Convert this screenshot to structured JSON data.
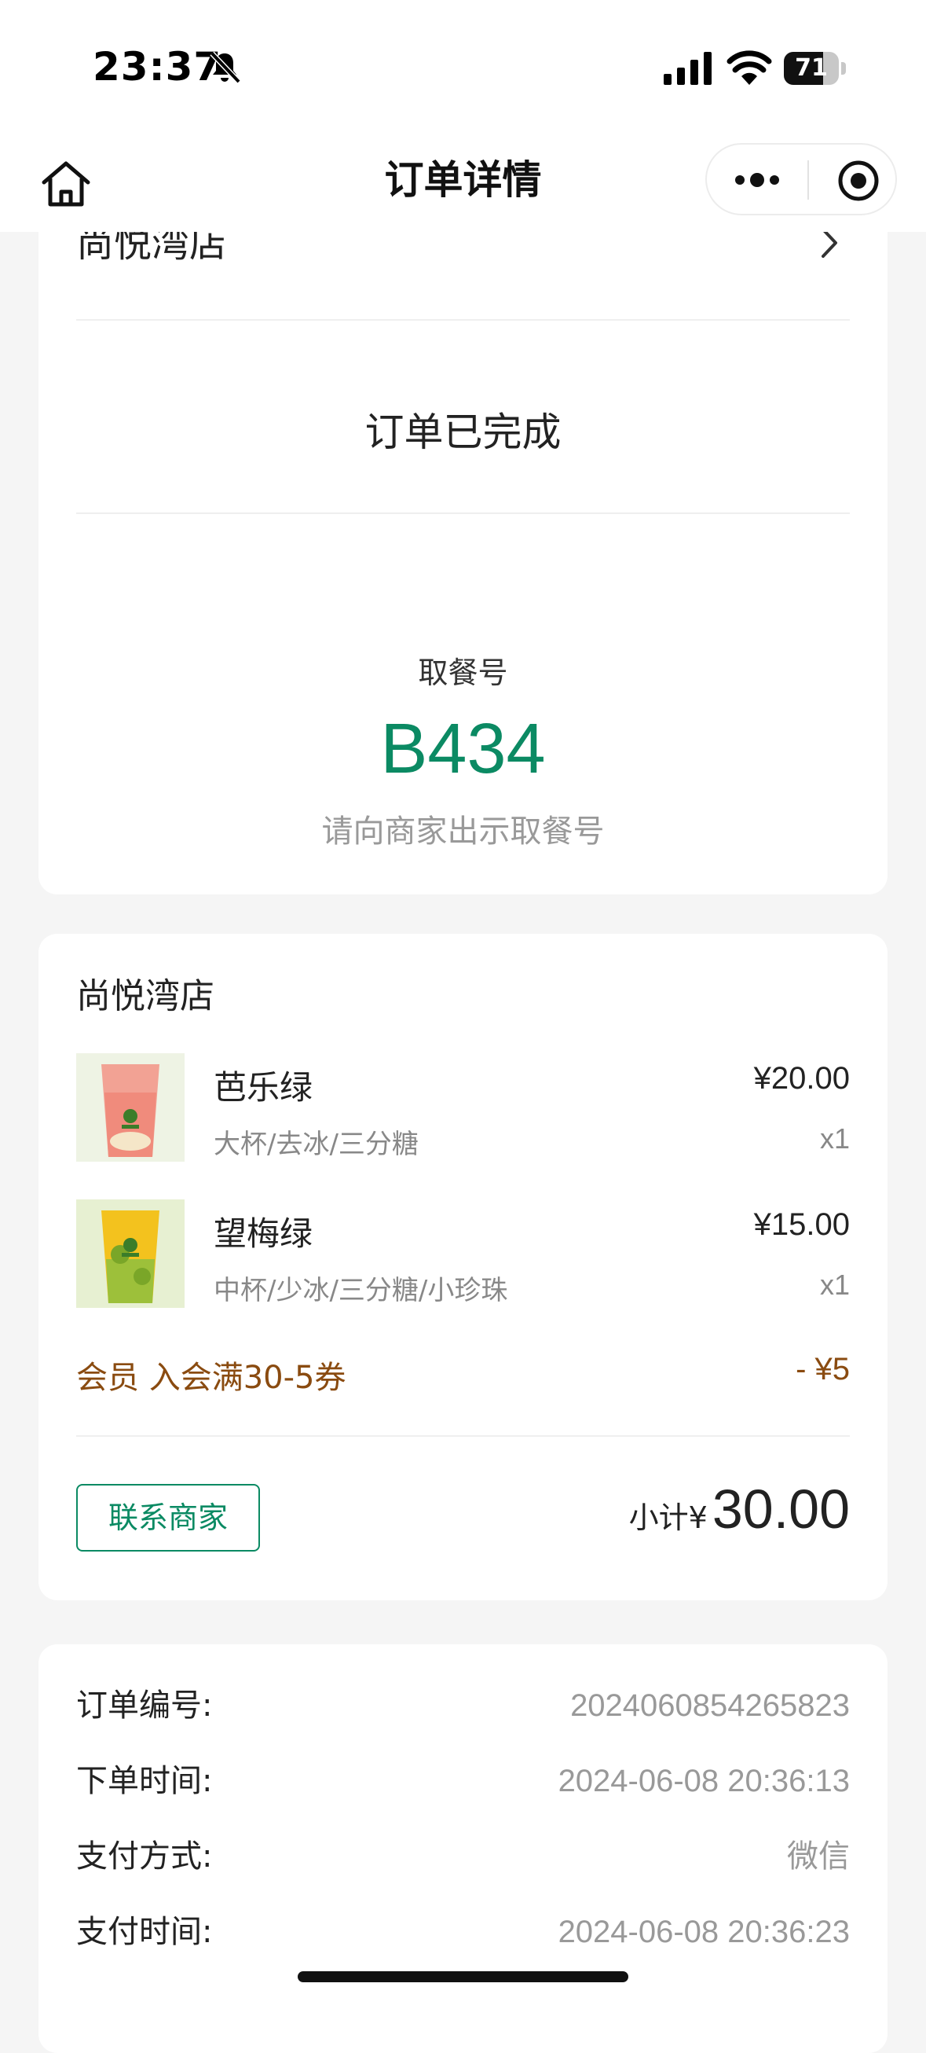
{
  "status_bar": {
    "time": "23:37",
    "battery": "71",
    "battery_level": 0.71
  },
  "nav": {
    "title": "订单详情"
  },
  "status_card": {
    "store_name": "尚悦湾店",
    "order_status": "订单已完成",
    "pickup_label": "取餐号",
    "pickup_number": "B434",
    "pickup_hint": "请向商家出示取餐号"
  },
  "order_card": {
    "store_name": "尚悦湾店",
    "items": [
      {
        "name": "芭乐绿",
        "spec": "大杯/去冰/三分糖",
        "price": "¥20.00",
        "qty": "x1"
      },
      {
        "name": "望梅绿",
        "spec": "中杯/少冰/三分糖/小珍珠",
        "price": "¥15.00",
        "qty": "x1"
      }
    ],
    "discount_label": "会员 入会满30-5券",
    "discount_amount": "- ¥5",
    "contact_label": "联系商家",
    "subtotal_label": "小计¥",
    "subtotal_amount": "30.00"
  },
  "info_card": {
    "rows": [
      {
        "label": "订单编号:",
        "value": "2024060854265823"
      },
      {
        "label": "下单时间:",
        "value": "2024-06-08 20:36:13"
      },
      {
        "label": "支付方式:",
        "value": "微信"
      },
      {
        "label": "支付时间:",
        "value": "2024-06-08 20:36:23"
      }
    ]
  },
  "colors": {
    "accent": "#0b8a63",
    "discount": "#8a4b10",
    "muted": "#999999"
  }
}
